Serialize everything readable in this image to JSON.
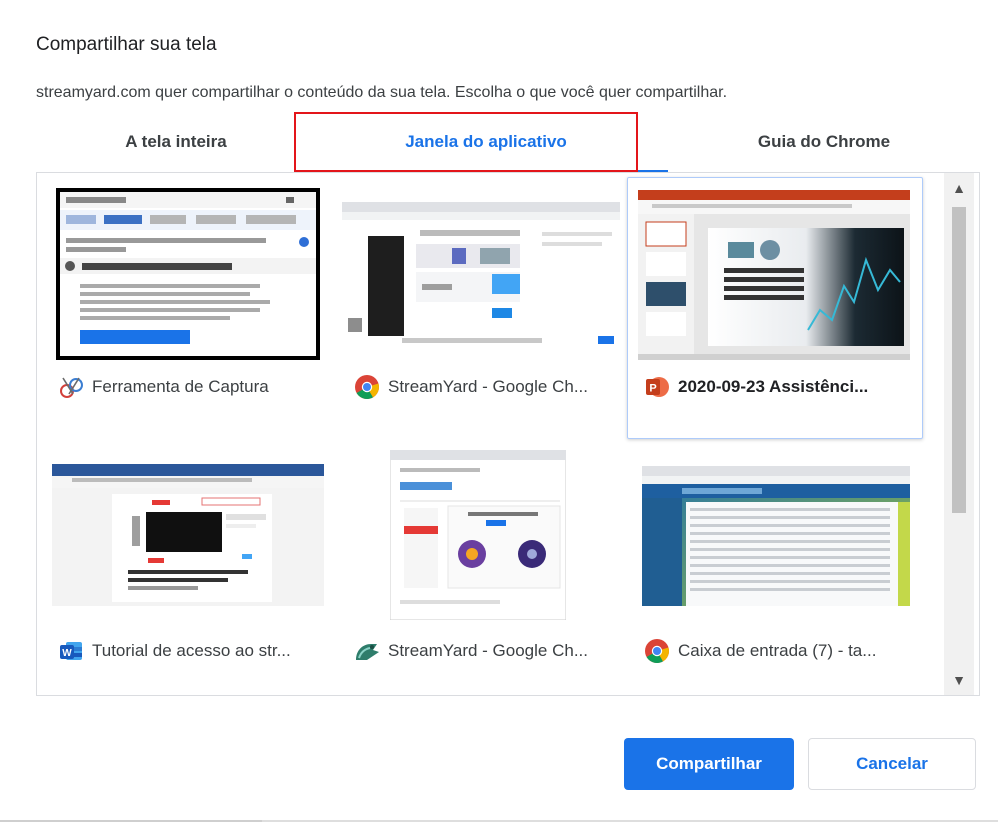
{
  "dialog": {
    "title": "Compartilhar sua tela",
    "subtitle": "streamyard.com quer compartilhar o conteúdo da sua tela. Escolha o que você quer compartilhar."
  },
  "tabs": [
    {
      "label": "A tela inteira",
      "selected": false
    },
    {
      "label": "Janela do aplicativo",
      "selected": true
    },
    {
      "label": "Guia do Chrome",
      "selected": false
    }
  ],
  "windows": [
    {
      "label": "Ferramenta de Captura",
      "icon": "snipping-tool-icon",
      "selected": false
    },
    {
      "label": "StreamYard - Google Ch...",
      "icon": "chrome-icon",
      "selected": false
    },
    {
      "label": "2020-09-23 Assistênci...",
      "icon": "powerpoint-icon",
      "selected": true
    },
    {
      "label": "Tutorial de acesso ao str...",
      "icon": "word-icon",
      "selected": false
    },
    {
      "label": "StreamYard - Google Ch...",
      "icon": "streamyard-app-icon",
      "selected": false
    },
    {
      "label": "Caixa de entrada (7) - ta...",
      "icon": "chrome-icon",
      "selected": false
    }
  ],
  "buttons": {
    "share": "Compartilhar",
    "cancel": "Cancelar"
  },
  "colors": {
    "accent": "#1a73e8",
    "highlight": "#e3151a"
  }
}
